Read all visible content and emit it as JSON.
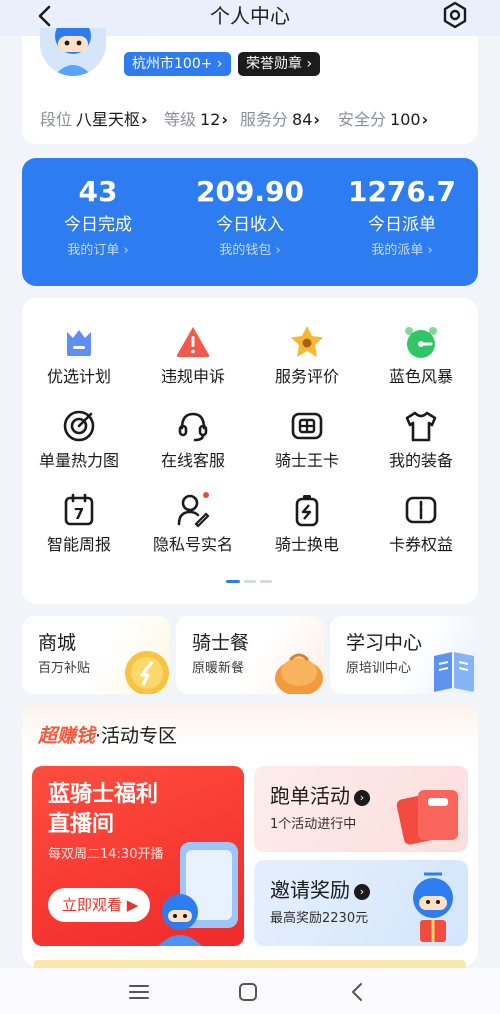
{
  "header": {
    "title": "个人中心",
    "back_icon": "back-arrow-icon",
    "settings_icon": "hexagon-settings-icon"
  },
  "profile": {
    "city_badge": "杭州市100+ ›",
    "honor_badge": "荣誉勋章 ›",
    "stats": [
      {
        "key": "段位",
        "value": "八星天枢"
      },
      {
        "key": "等级",
        "value": "12"
      },
      {
        "key": "服务分",
        "value": "84"
      },
      {
        "key": "安全分",
        "value": "100"
      }
    ],
    "chevron": "›"
  },
  "today": [
    {
      "number": "43",
      "label": "今日完成",
      "link": "我的订单 ›"
    },
    {
      "number": "209.90",
      "label": "今日收入",
      "link": "我的钱包 ›"
    },
    {
      "number": "1276.7",
      "label": "今日派单",
      "link": "我的派单 ›"
    }
  ],
  "grid": {
    "items": [
      {
        "label": "优选计划",
        "icon": "crown-icon"
      },
      {
        "label": "违规申诉",
        "icon": "warning-icon"
      },
      {
        "label": "服务评价",
        "icon": "star-icon"
      },
      {
        "label": "蓝色风暴",
        "icon": "alarm-clock-icon"
      },
      {
        "label": "单量热力图",
        "icon": "target-icon"
      },
      {
        "label": "在线客服",
        "icon": "headset-icon"
      },
      {
        "label": "骑士王卡",
        "icon": "card-icon"
      },
      {
        "label": "我的装备",
        "icon": "shirt-icon"
      },
      {
        "label": "智能周报",
        "icon": "calendar-icon"
      },
      {
        "label": "隐私号实名",
        "icon": "user-edit-icon"
      },
      {
        "label": "骑士换电",
        "icon": "battery-icon"
      },
      {
        "label": "卡券权益",
        "icon": "coupon-icon"
      }
    ],
    "calendar_day": "7",
    "active_color": "#2d7cf0"
  },
  "promos": [
    {
      "title": "商城",
      "subtitle": "百万补贴"
    },
    {
      "title": "骑士餐",
      "subtitle": "原暖新餐"
    },
    {
      "title": "学习中心",
      "subtitle": "原培训中心"
    }
  ],
  "activity": {
    "title_hot": "超赚钱",
    "title_rest": "·活动专区",
    "live": {
      "line1": "蓝骑士福利",
      "line2": "直播间",
      "schedule": "每双周二14:30开播",
      "button": "立即观看 ▶"
    },
    "run": {
      "title": "跑单活动",
      "subtitle": "1个活动进行中",
      "arrow": "›"
    },
    "invite": {
      "title": "邀请奖励",
      "subtitle": "最高奖励2230元",
      "arrow": "›"
    }
  },
  "colors": {
    "brand_blue": "#2d7cf0",
    "hot_red": "#f15a3b"
  }
}
